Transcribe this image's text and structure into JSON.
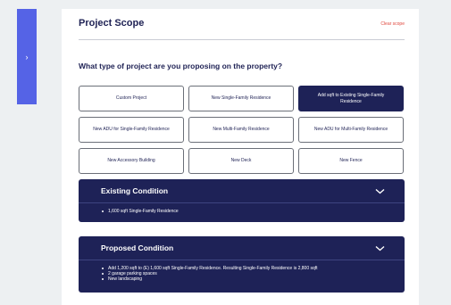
{
  "side_tab": {
    "icon": "chevron-right-icon",
    "glyph": "›"
  },
  "header": {
    "title": "Project Scope",
    "clear_label": "Clear scope"
  },
  "question": "What type of project are you proposing on the property?",
  "project_types": [
    {
      "label": "Custom Project",
      "selected": false
    },
    {
      "label": "New Single-Family Residence",
      "selected": false
    },
    {
      "label": "Add sqft to Existing Single-Family Residence",
      "selected": true
    },
    {
      "label": "New ADU for Single-Family Residence",
      "selected": false
    },
    {
      "label": "New Multi-Family Residence",
      "selected": false
    },
    {
      "label": "New ADU for Multi-Family Residence",
      "selected": false
    },
    {
      "label": "New Accessory Building",
      "selected": false
    },
    {
      "label": "New Deck",
      "selected": false
    },
    {
      "label": "New Fence",
      "selected": false
    }
  ],
  "existing_condition": {
    "title": "Existing Condition",
    "icon": "chevron-down-icon",
    "items": [
      "1,600 sqft Single-Family Residence"
    ]
  },
  "proposed_condition": {
    "title": "Proposed Condition",
    "icon": "chevron-down-icon",
    "items": [
      "Add 1,200 sqft to (E) 1,600 sqft Single-Family Residence. Resulting Single-Family Residence is 2,800 sqft",
      "2 garage parking spaces",
      "New landscaping"
    ]
  },
  "colors": {
    "accent": "#5563e6",
    "navy": "#1e2257",
    "danger": "#e0473d",
    "page_bg": "#edf0f2"
  }
}
